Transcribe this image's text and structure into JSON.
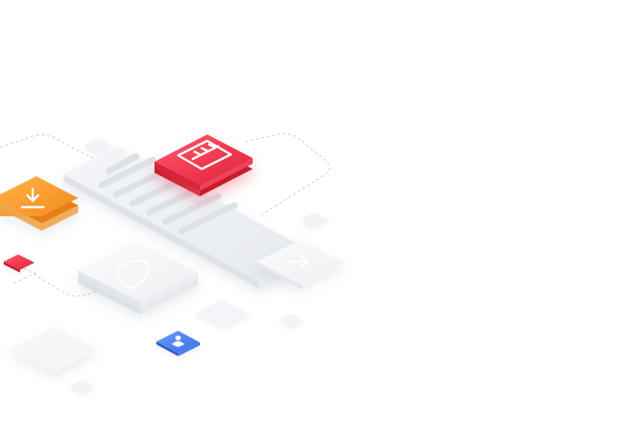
{
  "illustration": {
    "icons": {
      "download": "download-icon",
      "document": "document-list-icon",
      "shield": "shield-icon",
      "user": "user-icon",
      "arrow": "arrow-icon"
    },
    "colors": {
      "background": "#ffffff",
      "orange_tile": "#f59a2a",
      "red_tile": "#e8364b",
      "blue_tile": "#4a7fe8",
      "small_red_tile": "#e8364b",
      "glass_tile": "#eef1f5",
      "dashed_path": "#c9ced6"
    }
  }
}
